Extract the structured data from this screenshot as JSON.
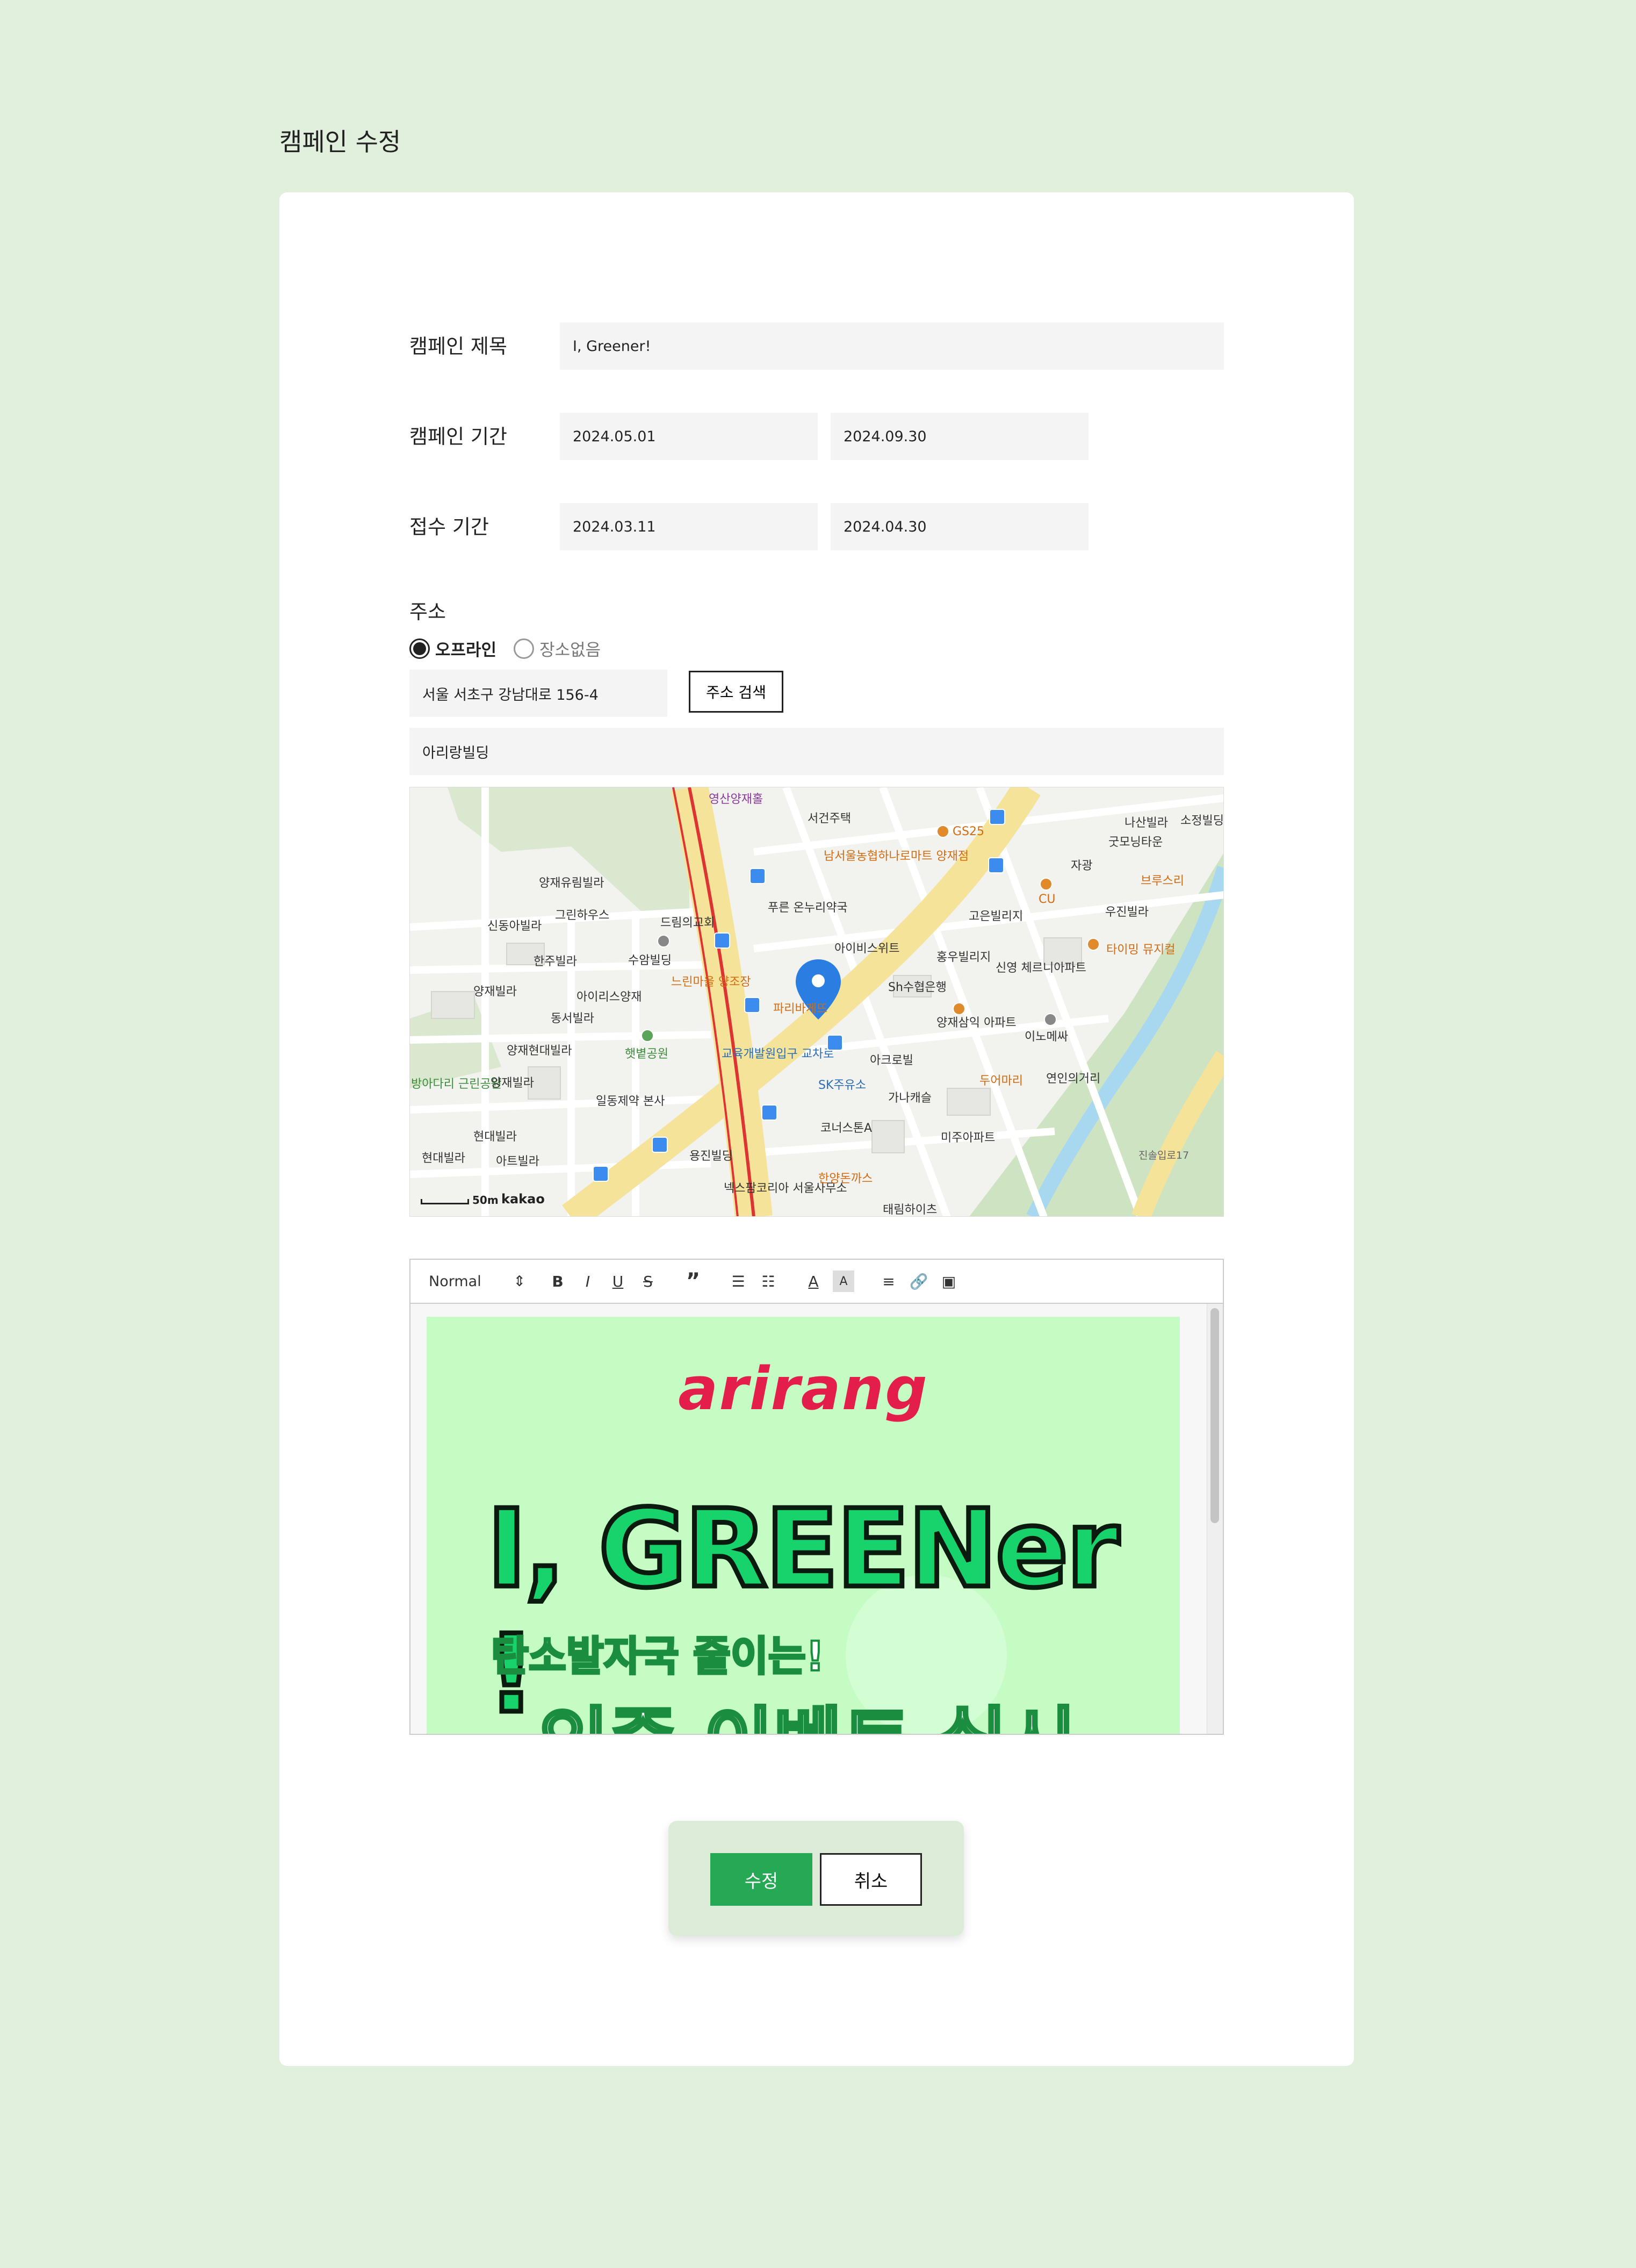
{
  "page": {
    "title": "캠페인 수정"
  },
  "form": {
    "title_label": "캠페인 제목",
    "title_value": "I, Greener!",
    "period_label": "캠페인 기간",
    "period_start": "2024.05.01",
    "period_end": "2024.09.30",
    "apply_label": "접수 기간",
    "apply_start": "2024.03.11",
    "apply_end": "2024.04.30",
    "address_label": "주소",
    "radio_offline": "오프라인",
    "radio_none": "장소없음",
    "address_value": "서울 서초구 강남대로 156-4",
    "address_search_label": "주소 검색",
    "address_detail": "아리랑빌딩"
  },
  "map": {
    "labels": [
      "영산양재홀",
      "서건주택",
      "소정빌딩",
      "나산빌라",
      "굿모닝타운",
      "GS25",
      "남서울농협하나로마트 양재점",
      "자광",
      "브루스리",
      "CU",
      "양재유림빌라",
      "그린하우스",
      "드림의교회",
      "푸른 온누리약국",
      "고은빌리지",
      "우진빌라",
      "신동아빌라",
      "한주빌라",
      "수암빌딩",
      "아이비스위트",
      "홍우빌리지",
      "신영 체르니아파트",
      "타이밍 뮤지컬",
      "양재빌라",
      "아이리스양재",
      "느린마을 양조장",
      "파리바게뜨",
      "Sh수협은행",
      "양재삼익 아파트",
      "이노메싸",
      "동서빌라",
      "양재현대빌라",
      "햇볕공원",
      "교육개발원입구 교차로",
      "아크로빌",
      "두어마리",
      "연인의거리",
      "방아다리 근린공원",
      "양재빌라",
      "일동제약 본사",
      "SK주유소",
      "가나캐슬",
      "현대빌라",
      "현대빌라",
      "아트빌라",
      "코너스톤A",
      "미주아파트",
      "용진빌딩",
      "넥스팜코리아 서울사무소",
      "한양돈까스",
      "태림하이츠",
      "진솔입로17",
      "50m",
      "kakao"
    ]
  },
  "editor": {
    "format_label": "Normal",
    "banner": {
      "brand": "arirang",
      "headline": "I, GREENer !",
      "sub1": "탄소발자국 줄이는!",
      "sub2": "인증 이벤트 실시"
    }
  },
  "actions": {
    "save_label": "수정",
    "cancel_label": "취소"
  },
  "colors": {
    "background": "#e1efdd",
    "accent": "#26a854",
    "banner": "#c5fcc3",
    "brand": "#e41e4a"
  }
}
